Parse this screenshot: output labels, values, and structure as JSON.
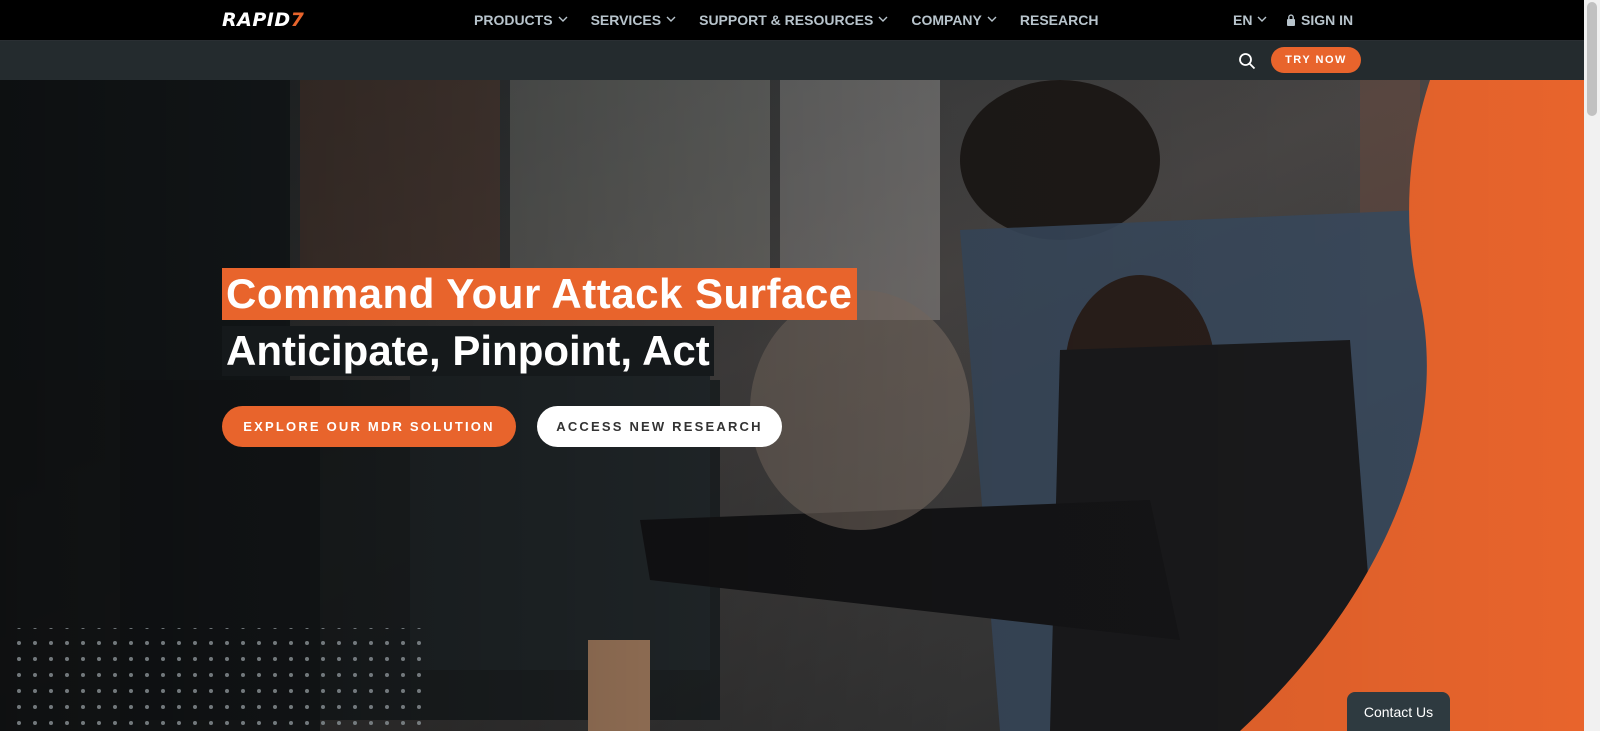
{
  "brand": {
    "logo_text": "RAPID",
    "logo_mark": "7",
    "accent": "#e8642c"
  },
  "nav": {
    "items": [
      {
        "label": "PRODUCTS",
        "has_dropdown": true
      },
      {
        "label": "SERVICES",
        "has_dropdown": true
      },
      {
        "label": "SUPPORT & RESOURCES",
        "has_dropdown": true
      },
      {
        "label": "COMPANY",
        "has_dropdown": true
      },
      {
        "label": "RESEARCH",
        "has_dropdown": false
      }
    ],
    "language": "EN",
    "signin": "SIGN IN"
  },
  "subbar": {
    "try_now": "TRY NOW",
    "search_icon": "search-icon"
  },
  "hero": {
    "headline": "Command Your Attack Surface",
    "subheadline": "Anticipate, Pinpoint, Act",
    "primary_cta": "EXPLORE OUR MDR SOLUTION",
    "secondary_cta": "ACCESS NEW RESEARCH"
  },
  "contact": {
    "label": "Contact Us"
  }
}
